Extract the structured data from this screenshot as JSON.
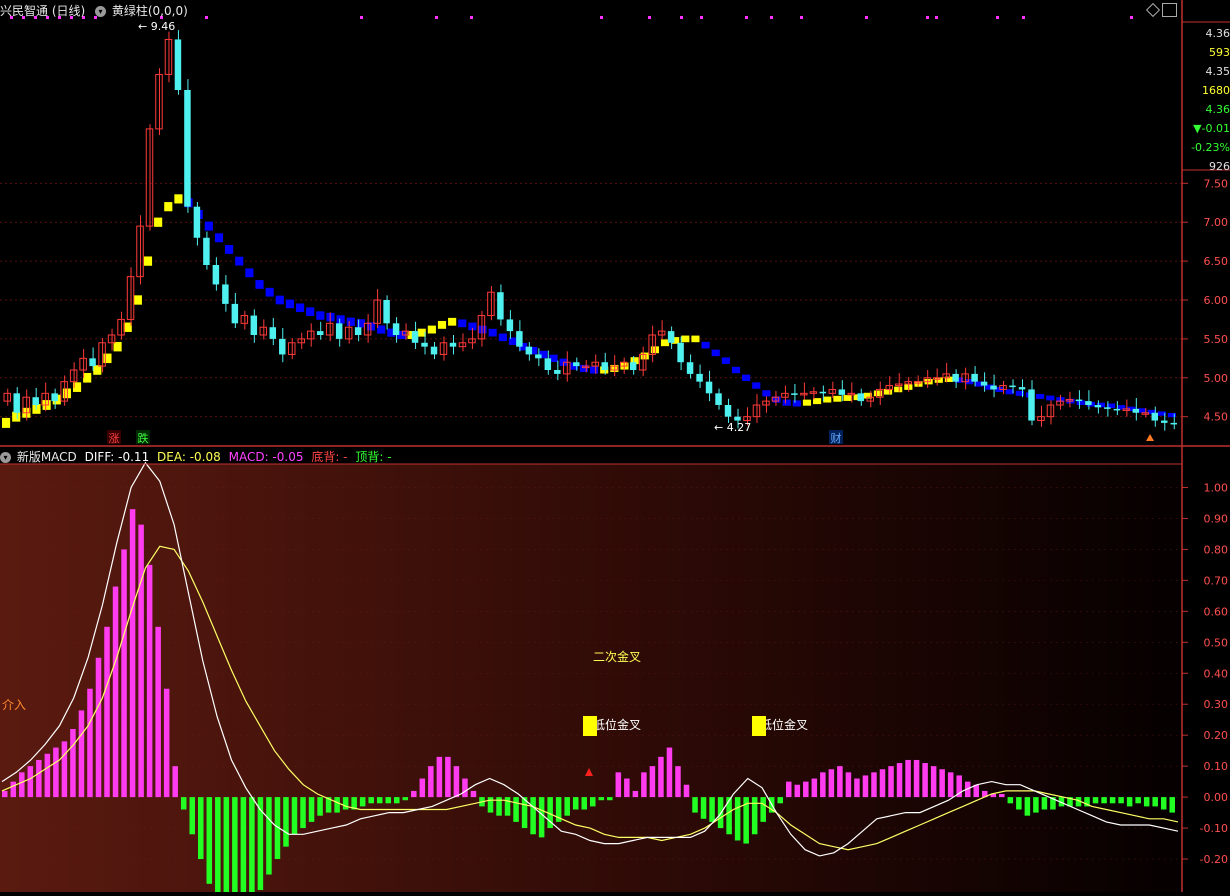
{
  "colors": {
    "up": "#ff3a3a",
    "down": "#4ef0f0",
    "macd_pos": "#ff3cf0",
    "macd_neg": "#22ff22",
    "diff_line": "#ffffff",
    "dea_line": "#ffff66",
    "axis_red": "#c03030",
    "axis_text": "#ff5050",
    "yellow_col": "#ffff00",
    "blue_col": "#0000ff",
    "dot_magenta": "#ff33ff"
  },
  "header": {
    "title": "兴民智通 (日线)",
    "indicator1_name": "黄绿柱",
    "indicator1_params": "(0,0,0)"
  },
  "right_panel": {
    "v1": "4.36",
    "v2": "593",
    "v3": "4.35",
    "v4": "1680",
    "v5": "4.36",
    "v6": "▼-0.01",
    "v7": "-0.23%",
    "v8": "926"
  },
  "price_axis": [
    "7.50",
    "7.00",
    "6.50",
    "6.00",
    "5.50",
    "5.00",
    "4.50"
  ],
  "macd_axis": [
    "1.00",
    "0.90",
    "0.80",
    "0.70",
    "0.60",
    "0.50",
    "0.40",
    "0.30",
    "0.20",
    "0.10",
    "0.00",
    "-0.10",
    "-0.20"
  ],
  "price_labels": {
    "high": "9.46",
    "low": "4.27",
    "zhang": "涨",
    "die": "跌",
    "cai": "财"
  },
  "macd_header": {
    "name": "新版MACD",
    "diff": "DIFF: -0.11",
    "dea": "DEA: -0.08",
    "macd": "MACD: -0.05",
    "dibei": "底背: -",
    "dingbei": "顶背: -"
  },
  "macd_labels": {
    "l1": "二次金叉",
    "l2": "低位金叉",
    "l3": "低位金叉",
    "l4": "介入"
  },
  "chart_data": [
    {
      "type": "candlestick",
      "title": "兴民智通 (日线)",
      "ylim": [
        4.2,
        9.6
      ],
      "series": [
        {
          "name": "price",
          "values": [
            4.8,
            4.55,
            4.75,
            4.65,
            4.8,
            4.7,
            4.95,
            5.1,
            5.25,
            5.15,
            5.45,
            5.55,
            5.75,
            6.3,
            6.95,
            8.2,
            8.9,
            9.35,
            8.7,
            7.2,
            6.8,
            6.45,
            6.2,
            5.95,
            5.7,
            5.8,
            5.55,
            5.65,
            5.5,
            5.3,
            5.45,
            5.5,
            5.6,
            5.55,
            5.7,
            5.5,
            5.65,
            5.55,
            5.7,
            6.0,
            5.7,
            5.55,
            5.6,
            5.45,
            5.4,
            5.3,
            5.45,
            5.4,
            5.45,
            5.5,
            5.8,
            6.1,
            5.75,
            5.6,
            5.4,
            5.3,
            5.25,
            5.1,
            5.05,
            5.2,
            5.15,
            5.15,
            5.2,
            5.1,
            5.15,
            5.2,
            5.1,
            5.3,
            5.55,
            5.6,
            5.45,
            5.2,
            5.05,
            4.95,
            4.8,
            4.65,
            4.5,
            4.45,
            4.5,
            4.65,
            4.7,
            4.75,
            4.8,
            4.78,
            4.8,
            4.82,
            4.8,
            4.85,
            4.78,
            4.8,
            4.7,
            4.75,
            4.85,
            4.9,
            4.92,
            4.95,
            4.95,
            5.0,
            5.0,
            5.05,
            4.95,
            5.05,
            4.95,
            4.9,
            4.85,
            4.9,
            4.88,
            4.85,
            4.45,
            4.5,
            4.65,
            4.7,
            4.72,
            4.7,
            4.65,
            4.62,
            4.6,
            4.58,
            4.6,
            4.55,
            4.55,
            4.45,
            4.42,
            4.4
          ]
        },
        {
          "name": "黄绿柱",
          "values": [
            4.42,
            4.5,
            4.55,
            4.6,
            4.65,
            4.72,
            4.8,
            4.88,
            5.0,
            5.1,
            5.25,
            5.4,
            5.65,
            6.0,
            6.5,
            7.0,
            7.2,
            7.3,
            7.25,
            7.1,
            6.95,
            6.8,
            6.65,
            6.5,
            6.35,
            6.2,
            6.1,
            6.0,
            5.95,
            5.9,
            5.85,
            5.8,
            5.78,
            5.75,
            5.72,
            5.7,
            5.66,
            5.62,
            5.58,
            5.55,
            5.55,
            5.58,
            5.62,
            5.68,
            5.72,
            5.7,
            5.66,
            5.62,
            5.58,
            5.52,
            5.47,
            5.4,
            5.35,
            5.3,
            5.25,
            5.2,
            5.15,
            5.12,
            5.1,
            5.1,
            5.12,
            5.15,
            5.22,
            5.28,
            5.36,
            5.45,
            5.48,
            5.5,
            5.5,
            5.42,
            5.32,
            5.22,
            5.1,
            5.0,
            4.9,
            4.8,
            4.72,
            4.68,
            4.67,
            4.68,
            4.7,
            4.72,
            4.73,
            4.74,
            4.75,
            4.77,
            4.8,
            4.82,
            4.85,
            4.88,
            4.92,
            4.95,
            4.97,
            4.98,
            4.97,
            4.95,
            4.92,
            4.88,
            4.85,
            4.82,
            4.8,
            4.78,
            4.76,
            4.74,
            4.72,
            4.7,
            4.68,
            4.66,
            4.65,
            4.64,
            4.62,
            4.6,
            4.58,
            4.56,
            4.54,
            4.52
          ]
        }
      ]
    },
    {
      "type": "bar",
      "title": "新版MACD",
      "ylim": [
        -0.3,
        1.05
      ],
      "series": [
        {
          "name": "MACD",
          "values": [
            0.02,
            0.05,
            0.08,
            0.1,
            0.12,
            0.14,
            0.16,
            0.18,
            0.22,
            0.28,
            0.35,
            0.45,
            0.55,
            0.68,
            0.8,
            0.93,
            0.88,
            0.75,
            0.55,
            0.35,
            0.1,
            -0.04,
            -0.12,
            -0.2,
            -0.28,
            -0.32,
            -0.36,
            -0.38,
            -0.37,
            -0.35,
            -0.3,
            -0.25,
            -0.2,
            -0.16,
            -0.12,
            -0.1,
            -0.08,
            -0.06,
            -0.05,
            -0.05,
            -0.04,
            -0.04,
            -0.03,
            -0.02,
            -0.02,
            -0.02,
            -0.02,
            -0.01,
            0.02,
            0.06,
            0.1,
            0.13,
            0.13,
            0.1,
            0.06,
            0.02,
            -0.03,
            -0.05,
            -0.06,
            -0.06,
            -0.08,
            -0.1,
            -0.12,
            -0.13,
            -0.1,
            -0.08,
            -0.06,
            -0.04,
            -0.04,
            -0.03,
            -0.01,
            -0.01,
            0.08,
            0.06,
            0.02,
            0.08,
            0.1,
            0.13,
            0.16,
            0.1,
            0.04,
            -0.05,
            -0.07,
            -0.08,
            -0.1,
            -0.12,
            -0.14,
            -0.15,
            -0.12,
            -0.08,
            -0.05,
            -0.02,
            0.05,
            0.04,
            0.05,
            0.06,
            0.08,
            0.09,
            0.1,
            0.08,
            0.06,
            0.07,
            0.08,
            0.09,
            0.1,
            0.11,
            0.12,
            0.12,
            0.11,
            0.1,
            0.09,
            0.08,
            0.07,
            0.05,
            0.04,
            0.02,
            0.01,
            0.01,
            -0.02,
            -0.04,
            -0.06,
            -0.05,
            -0.04,
            -0.04,
            -0.03,
            -0.03,
            -0.03,
            -0.03,
            -0.02,
            -0.02,
            -0.02,
            -0.02,
            -0.03,
            -0.02,
            -0.03,
            -0.03,
            -0.04,
            -0.05
          ]
        },
        {
          "name": "DIFF",
          "values": [
            0.05,
            0.08,
            0.12,
            0.17,
            0.23,
            0.32,
            0.45,
            0.62,
            0.82,
            1.0,
            1.08,
            1.02,
            0.88,
            0.66,
            0.44,
            0.26,
            0.12,
            0.03,
            -0.04,
            -0.09,
            -0.12,
            -0.12,
            -0.11,
            -0.1,
            -0.09,
            -0.07,
            -0.06,
            -0.05,
            -0.05,
            -0.04,
            -0.03,
            -0.01,
            0.01,
            0.04,
            0.06,
            0.04,
            0.01,
            -0.03,
            -0.07,
            -0.11,
            -0.12,
            -0.14,
            -0.15,
            -0.15,
            -0.14,
            -0.13,
            -0.13,
            -0.13,
            -0.13,
            -0.11,
            -0.06,
            0.01,
            0.06,
            0.03,
            -0.05,
            -0.12,
            -0.17,
            -0.19,
            -0.18,
            -0.15,
            -0.11,
            -0.07,
            -0.06,
            -0.05,
            -0.05,
            -0.03,
            -0.01,
            0.02,
            0.04,
            0.05,
            0.04,
            0.04,
            0.02,
            0.0,
            -0.02,
            -0.04,
            -0.06,
            -0.08,
            -0.09,
            -0.09,
            -0.09,
            -0.1,
            -0.11
          ]
        },
        {
          "name": "DEA",
          "values": [
            0.02,
            0.04,
            0.06,
            0.09,
            0.12,
            0.17,
            0.23,
            0.32,
            0.45,
            0.6,
            0.74,
            0.81,
            0.8,
            0.73,
            0.63,
            0.52,
            0.41,
            0.31,
            0.23,
            0.15,
            0.09,
            0.04,
            0.01,
            -0.01,
            -0.03,
            -0.04,
            -0.04,
            -0.04,
            -0.04,
            -0.04,
            -0.04,
            -0.04,
            -0.03,
            -0.02,
            -0.01,
            -0.01,
            -0.02,
            -0.03,
            -0.05,
            -0.07,
            -0.09,
            -0.1,
            -0.12,
            -0.13,
            -0.13,
            -0.13,
            -0.14,
            -0.13,
            -0.12,
            -0.1,
            -0.07,
            -0.04,
            -0.02,
            -0.02,
            -0.05,
            -0.09,
            -0.12,
            -0.15,
            -0.16,
            -0.17,
            -0.16,
            -0.15,
            -0.13,
            -0.11,
            -0.09,
            -0.07,
            -0.05,
            -0.03,
            -0.01,
            0.01,
            0.02,
            0.02,
            0.02,
            0.01,
            0.0,
            -0.01,
            -0.03,
            -0.04,
            -0.05,
            -0.06,
            -0.07,
            -0.07,
            -0.08
          ]
        }
      ]
    }
  ]
}
